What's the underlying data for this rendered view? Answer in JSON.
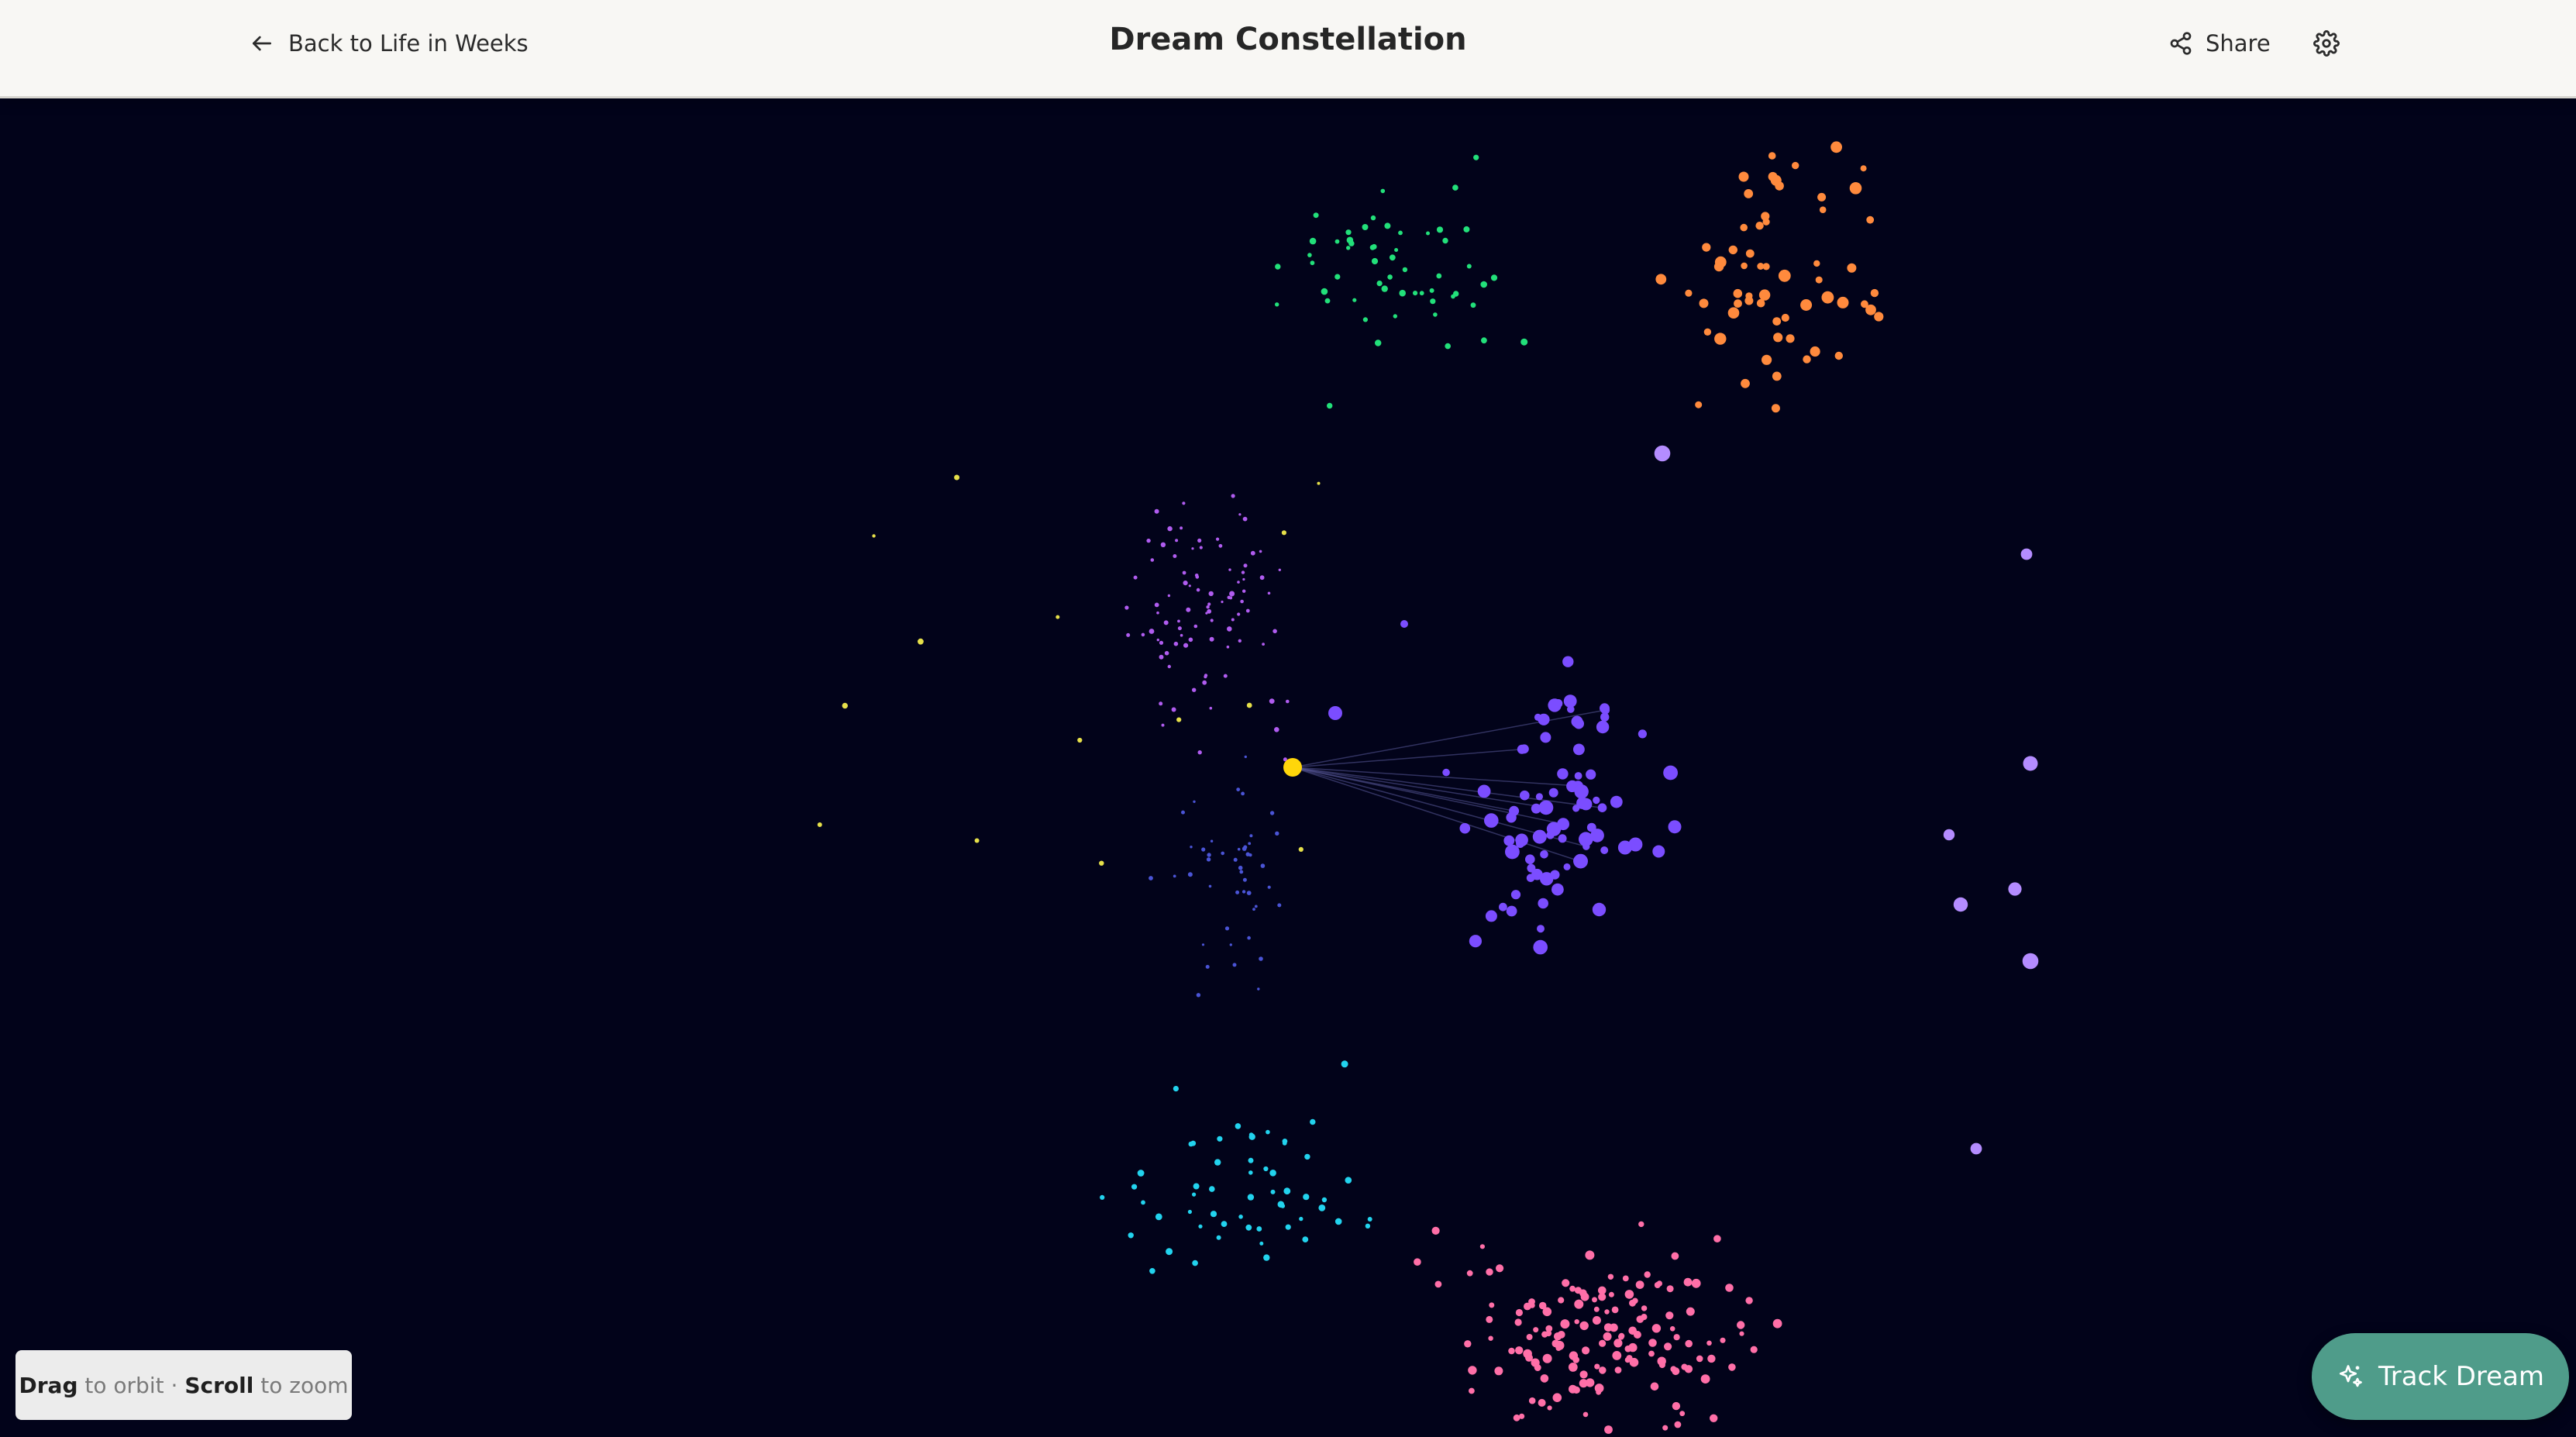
{
  "header": {
    "back_label": "Back to Life in Weeks",
    "title": "Dream Constellation",
    "share_label": "Share"
  },
  "hint": {
    "drag": "Drag",
    "orbit": "to orbit",
    "separator": "·",
    "scroll": "Scroll",
    "zoom": "to zoom"
  },
  "track_dream_label": "Track Dream",
  "icons": {
    "back": "arrow-left-icon",
    "share": "share-icon",
    "settings": "gear-icon",
    "track": "sparkles-icon"
  },
  "colors": {
    "background": "#02031a",
    "header_bg": "#f8f7f4",
    "accent": "#4f9c8a",
    "selected_star": "#ffd60a",
    "clusters": {
      "green": "#22e07a",
      "orange": "#ff8a3d",
      "purple": "#b05cf0",
      "violet": "#7b4dff",
      "blue": "#4a54d6",
      "cyan": "#22d3ee",
      "pink": "#ff6fa8"
    }
  }
}
